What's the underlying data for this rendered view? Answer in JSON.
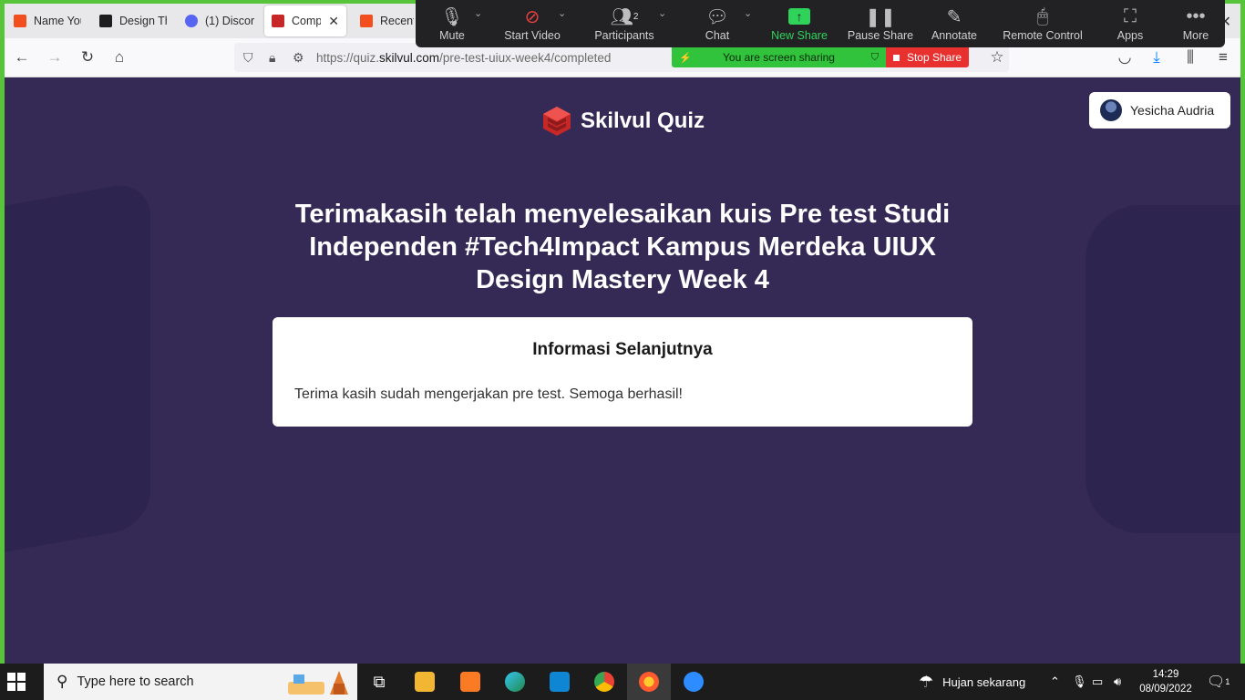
{
  "browser": {
    "tabs": [
      {
        "label": "Name You",
        "icon": "figma-icon",
        "color": "#f24e1e"
      },
      {
        "label": "Design Th",
        "icon": "figma-icon",
        "color": "#1e1e1e"
      },
      {
        "label": "(1) Discor",
        "icon": "discord-icon",
        "color": "#d93025"
      },
      {
        "label": "Compl",
        "icon": "skilvul-icon",
        "color": "#d32f2f"
      },
      {
        "label": "Recently",
        "icon": "figma-icon",
        "color": "#f24e1e"
      }
    ],
    "url_host": "https://quiz.",
    "url_domain": "skilvul.com",
    "url_path": "/pre-test-uiux-week4/completed"
  },
  "zoom": {
    "items": [
      "Mute",
      "Start Video",
      "Participants",
      "Chat",
      "New Share",
      "Pause Share",
      "Annotate",
      "Remote Control",
      "Apps",
      "More"
    ],
    "participants_count": "2",
    "sharing_text": "You are screen sharing",
    "stop_share": "Stop Share"
  },
  "page": {
    "brand": "Skilvul Quiz",
    "user": "Yesicha Audria",
    "title": "Terimakasih telah menyelesaikan kuis Pre test Studi Independen #Tech4Impact Kampus Merdeka UIUX Design Mastery Week 4",
    "info_title": "Informasi Selanjutnya",
    "info_text": "Terima kasih sudah mengerjakan pre test. Semoga berhasil!"
  },
  "taskbar": {
    "search_placeholder": "Type here to search",
    "weather": "Hujan sekarang",
    "time": "14:29",
    "date": "08/09/2022",
    "notifications": "1"
  },
  "colors": {
    "page_bg": "#352a55",
    "share_green": "#58c43a",
    "stop_red": "#e8312f"
  }
}
